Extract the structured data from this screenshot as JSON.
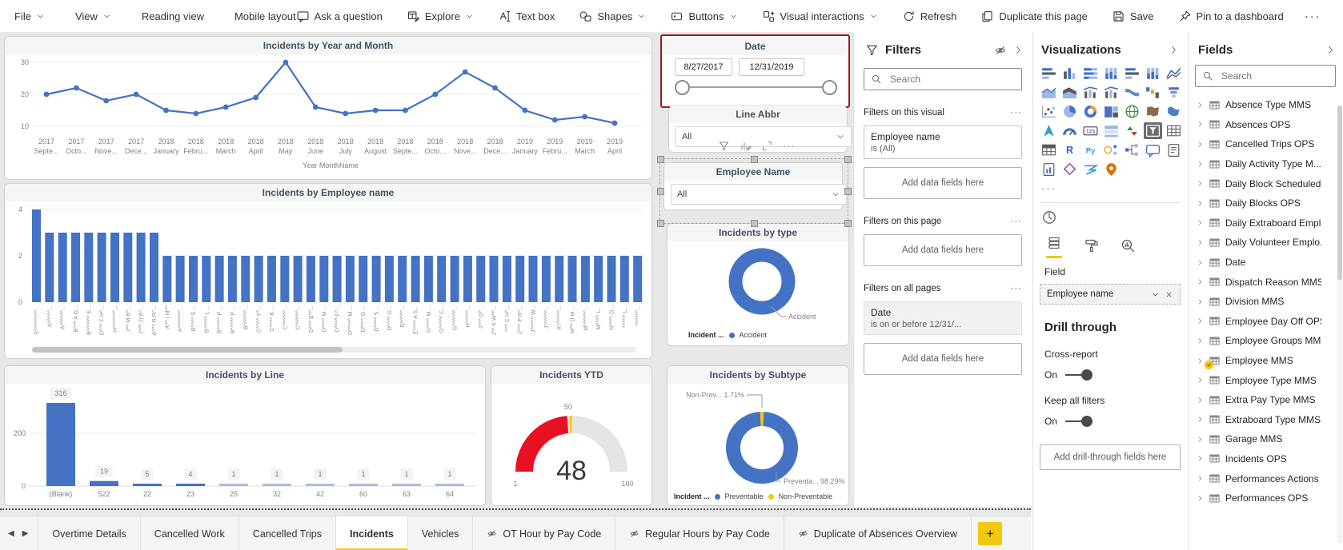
{
  "colors": {
    "accent": "#4472C4",
    "light_blue": "#A9BFE3",
    "yellow": "#F2C80F",
    "red": "#E81123",
    "selection_red": "#9B1C1F"
  },
  "menubar": {
    "left": [
      {
        "id": "file",
        "label": "File",
        "chevron": true
      },
      {
        "id": "view",
        "label": "View",
        "chevron": true
      },
      {
        "id": "reading-view",
        "label": "Reading view"
      },
      {
        "id": "mobile-layout",
        "label": "Mobile layout"
      }
    ],
    "right": [
      {
        "id": "ask-a-question",
        "label": "Ask a question",
        "icon": "chat"
      },
      {
        "id": "explore",
        "label": "Explore",
        "icon": "explore",
        "chevron": true
      },
      {
        "id": "text-box",
        "label": "Text box",
        "icon": "textbox"
      },
      {
        "id": "shapes",
        "label": "Shapes",
        "icon": "shapes",
        "chevron": true
      },
      {
        "id": "buttons",
        "label": "Buttons",
        "icon": "buttons",
        "chevron": true
      },
      {
        "id": "visual-interactions",
        "label": "Visual interactions",
        "icon": "interactions",
        "chevron": true
      },
      {
        "id": "refresh",
        "label": "Refresh",
        "icon": "refresh"
      },
      {
        "id": "duplicate-this-page",
        "label": "Duplicate this page",
        "icon": "duplicate"
      },
      {
        "id": "save",
        "label": "Save",
        "icon": "save"
      },
      {
        "id": "pin-to-a-dashboard",
        "label": "Pin to a dashboard",
        "icon": "pin"
      }
    ],
    "more": "···"
  },
  "chart_data": [
    {
      "type": "line",
      "title": "Incidents by Year and Month",
      "x_axis_label": "Year MonthName",
      "y_ticks": [
        10,
        20,
        30
      ],
      "categories": [
        [
          "2017",
          "Septe..."
        ],
        [
          "2017",
          "Octo..."
        ],
        [
          "2017",
          "Nove..."
        ],
        [
          "2017",
          "Dece..."
        ],
        [
          "2018",
          "January"
        ],
        [
          "2018",
          "Febru..."
        ],
        [
          "2018",
          "March"
        ],
        [
          "2018",
          "April"
        ],
        [
          "2018",
          "May"
        ],
        [
          "2018",
          "June"
        ],
        [
          "2018",
          "July"
        ],
        [
          "2018",
          "August"
        ],
        [
          "2018",
          "Septe..."
        ],
        [
          "2018",
          "Octo..."
        ],
        [
          "2018",
          "Nove..."
        ],
        [
          "2018",
          "Dece..."
        ],
        [
          "2019",
          "January"
        ],
        [
          "2019",
          "Febru..."
        ],
        [
          "2019",
          "March"
        ],
        [
          "2019",
          "April"
        ]
      ],
      "values": [
        20,
        22,
        18,
        20,
        15,
        14,
        16,
        19,
        30,
        16,
        14,
        15,
        15,
        20,
        27,
        22,
        15,
        12,
        13,
        11
      ]
    },
    {
      "type": "bar",
      "title": "Incidents by Employee name",
      "y_ticks": [
        0,
        2,
        4
      ],
      "values": [
        4,
        3,
        3,
        3,
        3,
        3,
        3,
        3,
        3,
        3,
        2,
        2,
        2,
        2,
        2,
        2,
        2,
        2,
        2,
        2,
        2,
        2,
        2,
        2,
        2,
        2,
        2,
        2,
        2,
        2,
        2,
        2,
        2,
        2,
        2,
        2,
        2,
        2,
        2,
        2,
        2,
        2,
        2,
        2,
        2,
        2,
        2
      ],
      "categories": [
        "S^^^^^^^^...",
        "A^^^^^...",
        "A^^^^^^...",
        "B^^^ A G...",
        "B^^^^^^ E...",
        "D^^^ F H^...",
        "H^^^^^^^...",
        "J^^ M B^...",
        "J^^^ D B^...",
        "A^^^ R R^...",
        "A^^ I M^^",
        "A^^^^^^^...",
        "B^^^^ S ...",
        "B^^^^^ L ...",
        "B^^^^^ P ...",
        "B^^^^^ P ...",
        "B^^^^^^...",
        "C^^^^ Y^...",
        "C^^^^ K ...",
        "C^^^^^^...",
        "C^^^^^^...",
        "D^^^ B^^...",
        "D^^^^ M ...",
        "D^^^^ F^...",
        "D^^^^^ M ...",
        "D^^^^ O ...",
        "D^^^^ S ...",
        "D^^^^ G...",
        "D^^^^^...",
        "E^^^^ A S...",
        "G^^^^ M ...",
        "G^^^^^ C...",
        "G^^^^^^...",
        "H^^^^^...",
        "J^^^ D^...",
        "J^^ K W^^...",
        "^^^ C H^...",
        "J^^^ P R^...",
        "J^^^^^ W...",
        "J^^^^^^...",
        "K^^^^^^...",
        "M^^ D M ...",
        "M^^^^^^...",
        "M^^^^ L...",
        "N^^^^ D...",
        "^^^^^ L...",
        "^^^^^^..."
      ]
    },
    {
      "type": "bar",
      "title": "Incidents by Line",
      "y_ticks": [
        0,
        200
      ],
      "categories": [
        "(Blank)",
        "522",
        "22",
        "23",
        "25",
        "32",
        "42",
        "60",
        "63",
        "64"
      ],
      "values": [
        316,
        19,
        5,
        4,
        1,
        1,
        1,
        1,
        1,
        1
      ]
    },
    {
      "type": "gauge",
      "title": "Incidents YTD",
      "min": 1,
      "max": 100,
      "value": 48,
      "target": 50
    },
    {
      "type": "donut",
      "title": "Incidents by type",
      "legend_title": "Incident ...",
      "slices": [
        {
          "label": "Accident",
          "pct": 100
        }
      ],
      "callout": "Accident"
    },
    {
      "type": "donut",
      "title": "Incidents by Subtype",
      "legend_title": "Incident ...",
      "slices": [
        {
          "label": "Preventable",
          "pct": 98.29
        },
        {
          "label": "Non-Preventable",
          "pct": 1.71
        }
      ],
      "callouts": [
        "Non-Prev... 1.71%",
        "Preventa... 98.29%"
      ]
    }
  ],
  "slicers": {
    "date": {
      "title": "Date",
      "start": "8/27/2017",
      "end": "12/31/2019"
    },
    "line_abbr": {
      "title": "Line Abbr",
      "value": "All"
    },
    "employee": {
      "title": "Employee Name",
      "value": "All"
    }
  },
  "filters_pane": {
    "title": "Filters",
    "search_placeholder": "Search",
    "sections": [
      {
        "heading": "Filters on this visual",
        "more": "···",
        "cards": [
          {
            "line1": "Employee name",
            "line2": "is (All)",
            "applied": false
          }
        ],
        "add_label": "Add data fields here"
      },
      {
        "heading": "Filters on this page",
        "more": "···",
        "cards": [],
        "add_label": "Add data fields here"
      },
      {
        "heading": "Filters on all pages",
        "more": "···",
        "cards": [
          {
            "line1": "Date",
            "line2": "is on or before 12/31/...",
            "applied": true
          }
        ],
        "add_label": "Add data fields here"
      }
    ]
  },
  "visualizations_pane": {
    "title": "Visualizations",
    "more": "···",
    "gallery": [
      "stacked-bar-chart",
      "stacked-column-chart",
      "clustered-bar-chart",
      "clustered-column-chart",
      "100-stacked-bar-chart",
      "100-stacked-column-chart",
      "line-chart",
      "area-chart",
      "stacked-area-chart",
      "line-and-stacked-column-chart",
      "line-and-clustered-column-chart",
      "ribbon-chart",
      "waterfall-chart",
      "funnel-chart",
      "scatter-chart",
      "pie-chart",
      "donut-chart",
      "treemap",
      "map",
      "filled-map",
      "shape-map",
      "azure-map",
      "gauge",
      "card",
      "multi-row-card",
      "kpi",
      "slicer",
      "table",
      "matrix",
      "r-script-visual",
      "python-visual",
      "key-influencers",
      "decomposition-tree",
      "q-and-a",
      "smart-narrative",
      "paginated-report",
      "power-apps",
      "power-automate",
      "arcgis-map"
    ],
    "selected_visual": "slicer",
    "field_section_label": "Field",
    "field_well_value": "Employee name",
    "drill_through": {
      "heading": "Drill through",
      "cross_report_label": "Cross-report",
      "cross_report_state": "On",
      "keep_filters_label": "Keep all filters",
      "keep_filters_state": "On",
      "add_label": "Add drill-through fields here"
    }
  },
  "fields_pane": {
    "title": "Fields",
    "search_placeholder": "Search",
    "tables": [
      {
        "name": "Absence Type MMS"
      },
      {
        "name": "Absences OPS"
      },
      {
        "name": "Cancelled Trips OPS"
      },
      {
        "name": "Daily Activity Type M..."
      },
      {
        "name": "Daily Block Scheduled..."
      },
      {
        "name": "Daily Blocks OPS"
      },
      {
        "name": "Daily Extraboard Empl..."
      },
      {
        "name": "Daily Volunteer Emplo..."
      },
      {
        "name": "Date"
      },
      {
        "name": "Dispatch Reason MMS"
      },
      {
        "name": "Division MMS"
      },
      {
        "name": "Employee Day Off OPS"
      },
      {
        "name": "Employee Groups MMS"
      },
      {
        "name": "Employee MMS",
        "badge": true
      },
      {
        "name": "Employee Type MMS"
      },
      {
        "name": "Extra Pay Type MMS"
      },
      {
        "name": "Extraboard Type MMS"
      },
      {
        "name": "Garage MMS"
      },
      {
        "name": "Incidents OPS"
      },
      {
        "name": "Performances Actions ..."
      },
      {
        "name": "Performances OPS"
      }
    ]
  },
  "tab_bar": {
    "nav_prev": "◀",
    "nav_next": "▶",
    "tabs": [
      {
        "label": "Overtime Details"
      },
      {
        "label": "Cancelled Work"
      },
      {
        "label": "Cancelled Trips"
      },
      {
        "label": "Incidents",
        "active": true
      },
      {
        "label": "Vehicles"
      },
      {
        "label": "OT Hour by Pay Code",
        "hidden_icon": true
      },
      {
        "label": "Regular Hours by Pay Code",
        "hidden_icon": true
      },
      {
        "label": "Duplicate of Absences Overview",
        "hidden_icon": true
      }
    ],
    "add_label": "+"
  }
}
